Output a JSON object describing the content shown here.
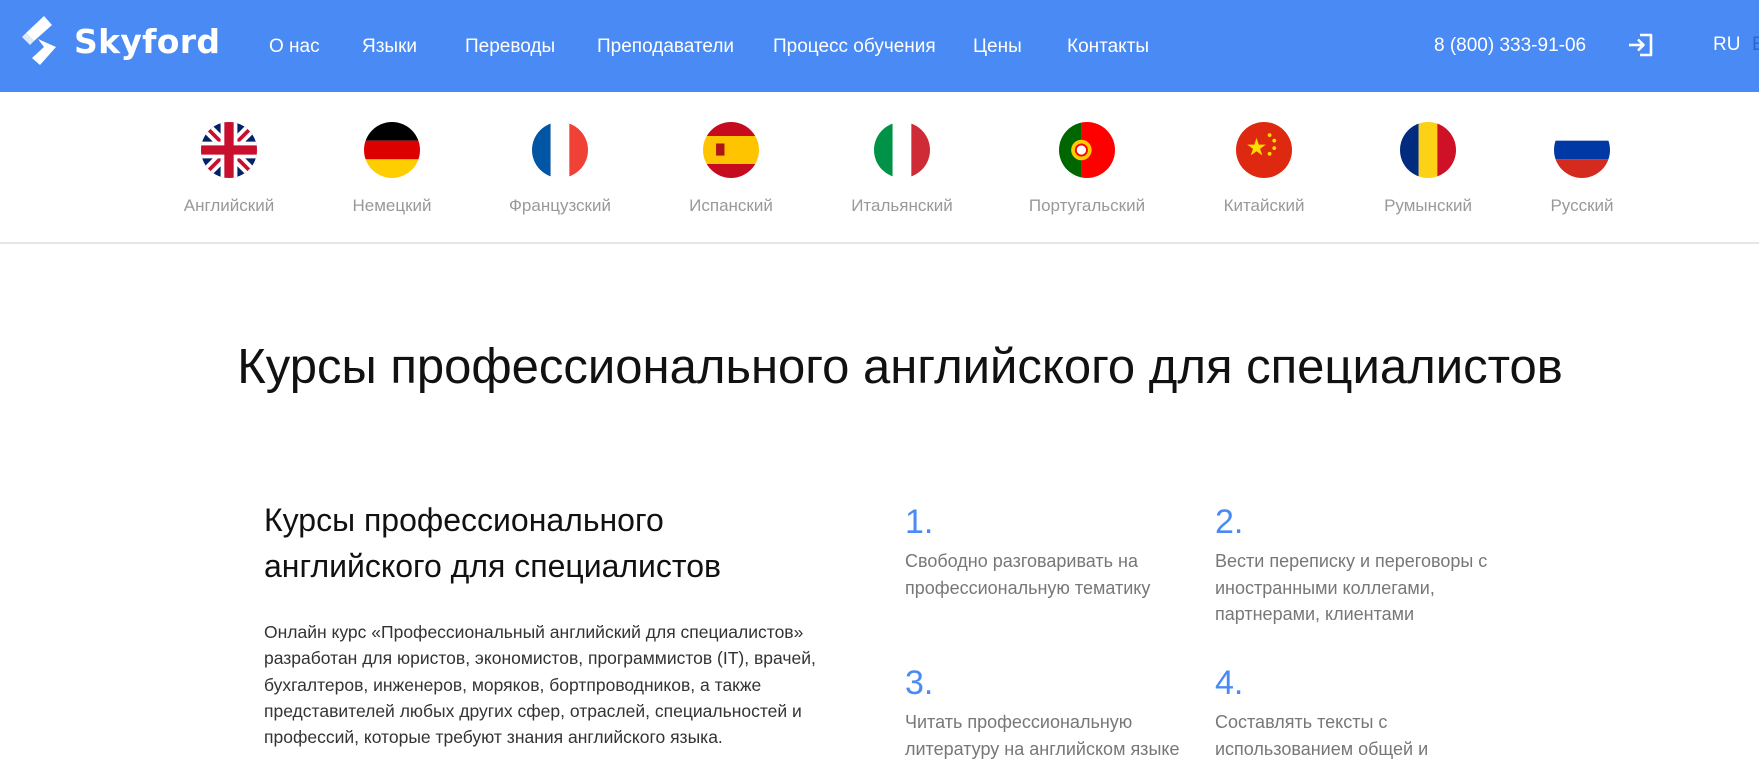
{
  "header": {
    "logo_text": "Skyford",
    "brand_color": "#4a8af4",
    "nav": [
      "О нас",
      "Языки",
      "Переводы",
      "Преподаватели",
      "Процесс обучения",
      "Цены",
      "Контакты"
    ],
    "phone": "8 (800) 333-91-06",
    "login_icon": "login-icon",
    "lang_active": "RU",
    "lang_other": "E"
  },
  "languages": [
    {
      "name": "Английский",
      "flag": "uk-flag-icon"
    },
    {
      "name": "Немецкий",
      "flag": "germany-flag-icon"
    },
    {
      "name": "Французский",
      "flag": "france-flag-icon"
    },
    {
      "name": "Испанский",
      "flag": "spain-flag-icon"
    },
    {
      "name": "Итальянский",
      "flag": "italy-flag-icon"
    },
    {
      "name": "Португальский",
      "flag": "portugal-flag-icon"
    },
    {
      "name": "Китайский",
      "flag": "china-flag-icon"
    },
    {
      "name": "Румынский",
      "flag": "romania-flag-icon"
    },
    {
      "name": "Русский",
      "flag": "russia-flag-icon"
    }
  ],
  "main": {
    "title": "Курсы профессионального английского для специалистов",
    "subtitle": "Курсы профессионального английского для специалистов",
    "description": "Онлайн курс «Профессиональный английский для специалистов» разработан для юристов, экономистов, программистов (IT), врачей, бухгалтеров, инженеров, моряков, бортпроводников, а также представителей любых других сфер, отраслей, специальностей и профессий, которые требуют знания английского языка.",
    "points": [
      {
        "num": "1.",
        "text": "Свободно разговаривать на профессиональную тематику"
      },
      {
        "num": "2.",
        "text": "Вести переписку и переговоры с иностранными коллегами, партнерами, клиентами"
      },
      {
        "num": "3.",
        "text": "Читать профессиональную литературу на английском языке"
      },
      {
        "num": "4.",
        "text": "Составлять тексты с использованием общей и"
      }
    ]
  }
}
